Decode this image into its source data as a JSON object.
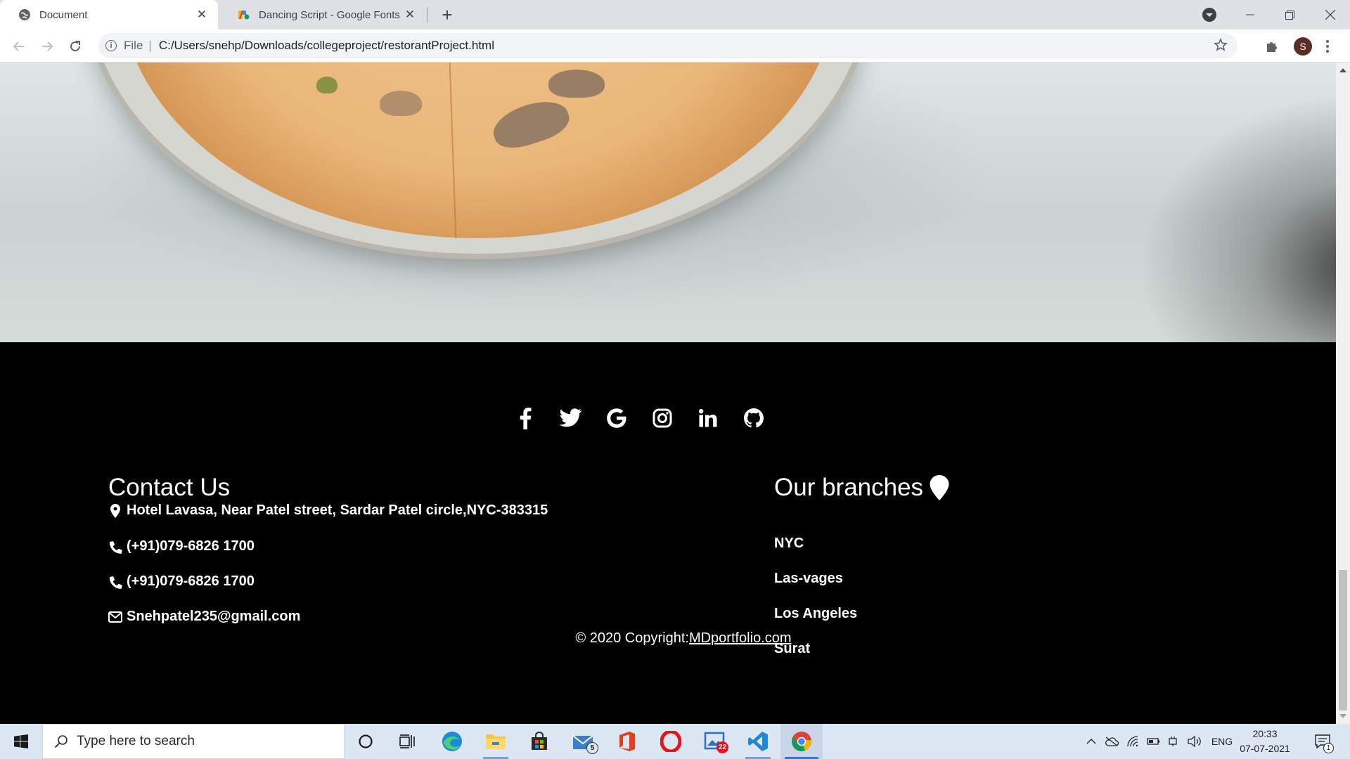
{
  "browser": {
    "tabs": [
      {
        "title": "Document",
        "active": true
      },
      {
        "title": "Dancing Script - Google Fonts",
        "active": false
      }
    ],
    "address": {
      "scheme": "File",
      "url": "C:/Users/snehp/Downloads/collegeproject/restorantProject.html"
    },
    "profile_initial": "S"
  },
  "footer": {
    "social_icons": [
      "facebook-icon",
      "twitter-icon",
      "google-icon",
      "instagram-icon",
      "linkedin-icon",
      "github-icon"
    ],
    "contact": {
      "title": "Contact Us",
      "address": "Hotel Lavasa, Near Patel street, Sardar Patel circle,NYC-383315",
      "phone1": "(+91)079-6826 1700",
      "phone2": "(+91)079-6826 1700",
      "email": "Snehpatel235@gmail.com"
    },
    "branches": {
      "title": "Our branches",
      "items": [
        "NYC",
        "Las-vages",
        "Los Angeles",
        "Surat"
      ]
    },
    "copyright": {
      "prefix": "© 2020 Copyright:",
      "link": "MDportfolio.com"
    }
  },
  "taskbar": {
    "search_placeholder": "Type here to search",
    "mail_badge": "5",
    "photos_badge": "22",
    "lang": "ENG",
    "time": "20:33",
    "date": "07-07-2021",
    "notification_count": "1"
  }
}
